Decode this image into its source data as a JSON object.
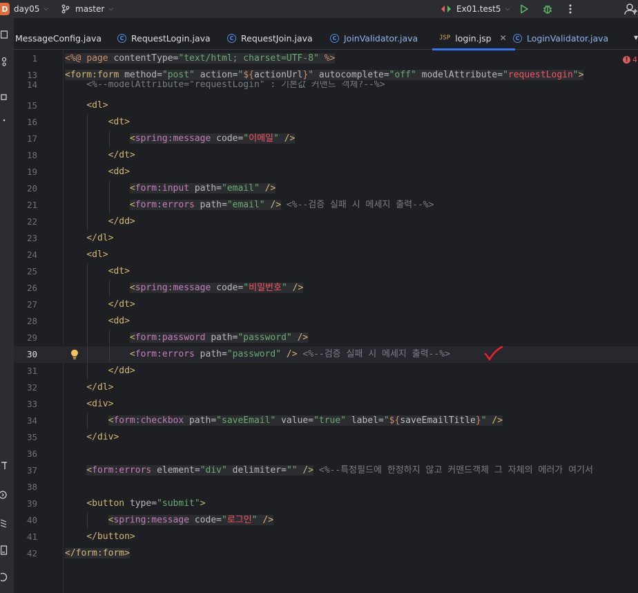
{
  "titlebar": {
    "project_badge": "D",
    "project_name": "day05",
    "branch_name": "master",
    "run_config": "Ex01.test5"
  },
  "tabs": [
    {
      "label": "MessageConfig.java",
      "type": "java"
    },
    {
      "label": "RequestLogin.java",
      "type": "class"
    },
    {
      "label": "RequestJoin.java",
      "type": "class"
    },
    {
      "label": "JoinValidator.java",
      "type": "class"
    },
    {
      "label": "login.jsp",
      "type": "jsp",
      "active": true
    },
    {
      "label": "LoginValidator.java",
      "type": "class"
    }
  ],
  "tab_icons": {
    "class": "C",
    "jsp": "JSP"
  },
  "problems": {
    "count": "4"
  },
  "editor": {
    "current_line": "30",
    "line_numbers": [
      "1",
      "13",
      "14",
      "15",
      "16",
      "17",
      "18",
      "19",
      "20",
      "21",
      "22",
      "23",
      "24",
      "25",
      "26",
      "27",
      "28",
      "29",
      "30",
      "31",
      "32",
      "33",
      "34",
      "35",
      "36",
      "37",
      "38",
      "39",
      "40",
      "41",
      "42"
    ]
  },
  "colors": {
    "accent": "#3574f0",
    "tag": "#d5b778",
    "string": "#6aab73",
    "comment": "#7a7e85",
    "annotation_check": "#e8222e"
  }
}
